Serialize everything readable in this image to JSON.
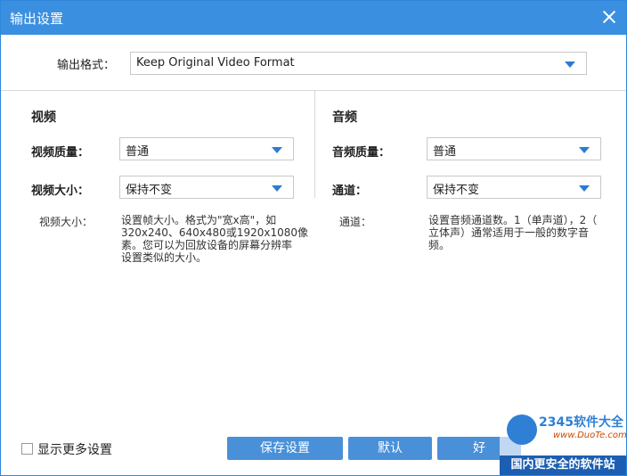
{
  "window": {
    "title": "输出设置"
  },
  "format": {
    "label": "输出格式：",
    "value": "Keep Original Video Format"
  },
  "video": {
    "section_title": "视频",
    "quality_label": "视频质量：",
    "quality_value": "普通",
    "size_label": "视频大小：",
    "size_value": "保持不变",
    "desc_label": "视频大小：",
    "desc_lines": [
      "设置帧大小。格式为\"宽x高\"，如",
      "320x240、640x480或1920x1080像",
      "素。您可以为回放设备的屏幕分辨率",
      "设置类似的大小。"
    ]
  },
  "audio": {
    "section_title": "音频",
    "quality_label": "音频质量：",
    "quality_value": "普通",
    "channel_label": "通道：",
    "channel_value": "保持不变",
    "desc_label": "通道：",
    "desc_lines": [
      "设置音频通道数。1（单声道），2（",
      "立体声）通常适用于一般的数字音",
      "频。"
    ]
  },
  "footer": {
    "more_label": "显示更多设置",
    "save_label": "保存设置",
    "default_label": "默认",
    "ok_label": "好"
  },
  "watermark": {
    "brand": "2345软件大全",
    "url": "www.DuoTe.com",
    "tagline": "国内更安全的软件站"
  }
}
